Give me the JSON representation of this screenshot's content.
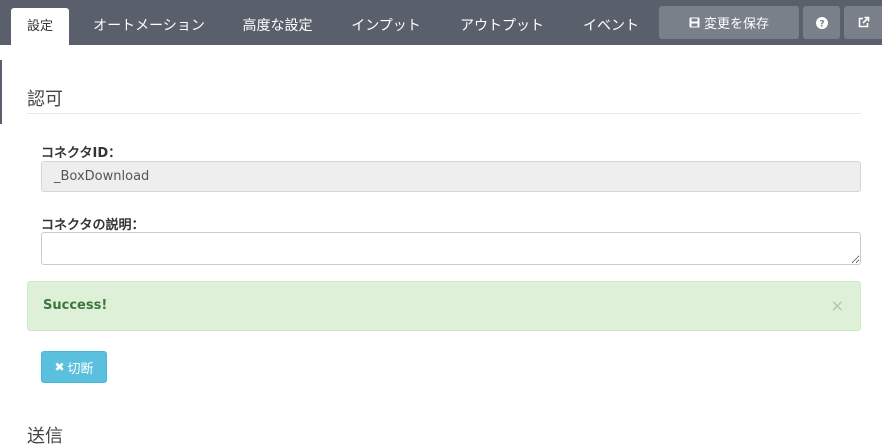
{
  "tabs": [
    {
      "label": "設定",
      "active": true
    },
    {
      "label": "オートメーション",
      "active": false
    },
    {
      "label": "高度な設定",
      "active": false
    },
    {
      "label": "インプット",
      "active": false
    },
    {
      "label": "アウトプット",
      "active": false
    },
    {
      "label": "イベント",
      "active": false
    }
  ],
  "toolbar": {
    "save_label": "変更を保存",
    "save_icon": "floppy-disk-icon",
    "help_icon": "question-circle-icon",
    "external_icon": "external-link-icon"
  },
  "auth_section": {
    "title": "認可",
    "connector_id_label": "コネクタID：",
    "connector_id_value": "_BoxDownload",
    "description_label": "コネクタの説明：",
    "description_value": "",
    "alert_text": "Success!",
    "alert_close": "×",
    "disconnect_label": "切断",
    "disconnect_icon": "close-icon"
  },
  "next_section": {
    "title": "送信"
  },
  "colors": {
    "topbar": "#59606b",
    "alert_bg": "#dff0d8",
    "alert_text": "#3c763d",
    "info_button": "#5bc0de"
  }
}
